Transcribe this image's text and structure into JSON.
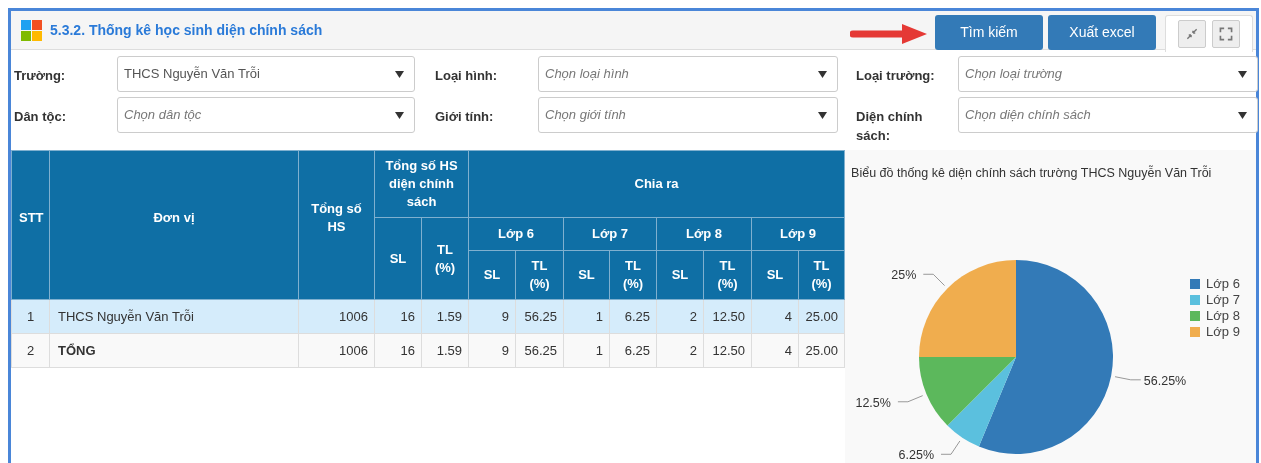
{
  "header": {
    "title": "5.3.2. Thống kê học sinh diện chính sách",
    "buttons": [
      "Tìm kiếm",
      "Xuất excel"
    ]
  },
  "filters": [
    {
      "label": "Trường:",
      "value": "THCS Nguyễn Văn Trỗi"
    },
    {
      "label": "Loại hình:",
      "placeholder": "Chọn loại hình"
    },
    {
      "label": "Loại trường:",
      "placeholder": "Chọn loại trường"
    },
    {
      "label": "Dân tộc:",
      "placeholder": "Chọn dân tộc"
    },
    {
      "label": "Giới tính:",
      "placeholder": "Chọn giới tính"
    },
    {
      "label": "Diện chính sách:",
      "placeholder": "Chọn diện chính sách"
    }
  ],
  "table": {
    "header_rows": [
      [
        {
          "text": "STT",
          "rowspan": 3
        },
        {
          "text": "Đơn vị",
          "rowspan": 3
        },
        {
          "text": "Tổng số HS",
          "rowspan": 3
        },
        {
          "text": "Tổng số HS diện chính sách",
          "colspan": 2
        },
        {
          "text": "Chia ra",
          "colspan": 8
        }
      ],
      [
        {
          "text": "SL",
          "rowspan": 2
        },
        {
          "text": "TL (%)",
          "rowspan": 2
        },
        {
          "text": "Lớp 6",
          "colspan": 2
        },
        {
          "text": "Lớp 7",
          "colspan": 2
        },
        {
          "text": "Lớp 8",
          "colspan": 2
        },
        {
          "text": "Lớp 9",
          "colspan": 2
        }
      ],
      [
        {
          "text": "SL"
        },
        {
          "text": "TL (%)"
        },
        {
          "text": "SL"
        },
        {
          "text": "TL (%)"
        },
        {
          "text": "SL"
        },
        {
          "text": "TL (%)"
        },
        {
          "text": "SL"
        },
        {
          "text": "TL (%)"
        }
      ]
    ],
    "rows": [
      {
        "kind": "unit",
        "selected": true,
        "cells": [
          "1",
          "THCS Nguyễn Văn Trỗi",
          "1006",
          "16",
          "1.59",
          "9",
          "56.25",
          "1",
          "6.25",
          "2",
          "12.50",
          "4",
          "25.00"
        ]
      },
      {
        "kind": "total",
        "selected": false,
        "cells": [
          "2",
          "TỔNG",
          "1006",
          "16",
          "1.59",
          "9",
          "56.25",
          "1",
          "6.25",
          "2",
          "12.50",
          "4",
          "25.00"
        ]
      }
    ]
  },
  "chart": {
    "chart_data": {
      "type": "pie",
      "title": "Biểu đồ thống kê diện chính sách trường THCS Nguyễn Văn Trỗi",
      "categories": [
        "Lớp 6",
        "Lớp 7",
        "Lớp 8",
        "Lớp 9"
      ],
      "series": [
        {
          "values": [
            56.25,
            6.25,
            12.5,
            25
          ]
        }
      ],
      "legend": true,
      "colors": [
        "#337ab7",
        "#5bc0de",
        "#5cb85c",
        "#f0ad4e"
      ],
      "value_labels": [
        "56.25%",
        "6.25%",
        "12.5%",
        "25%"
      ]
    }
  }
}
